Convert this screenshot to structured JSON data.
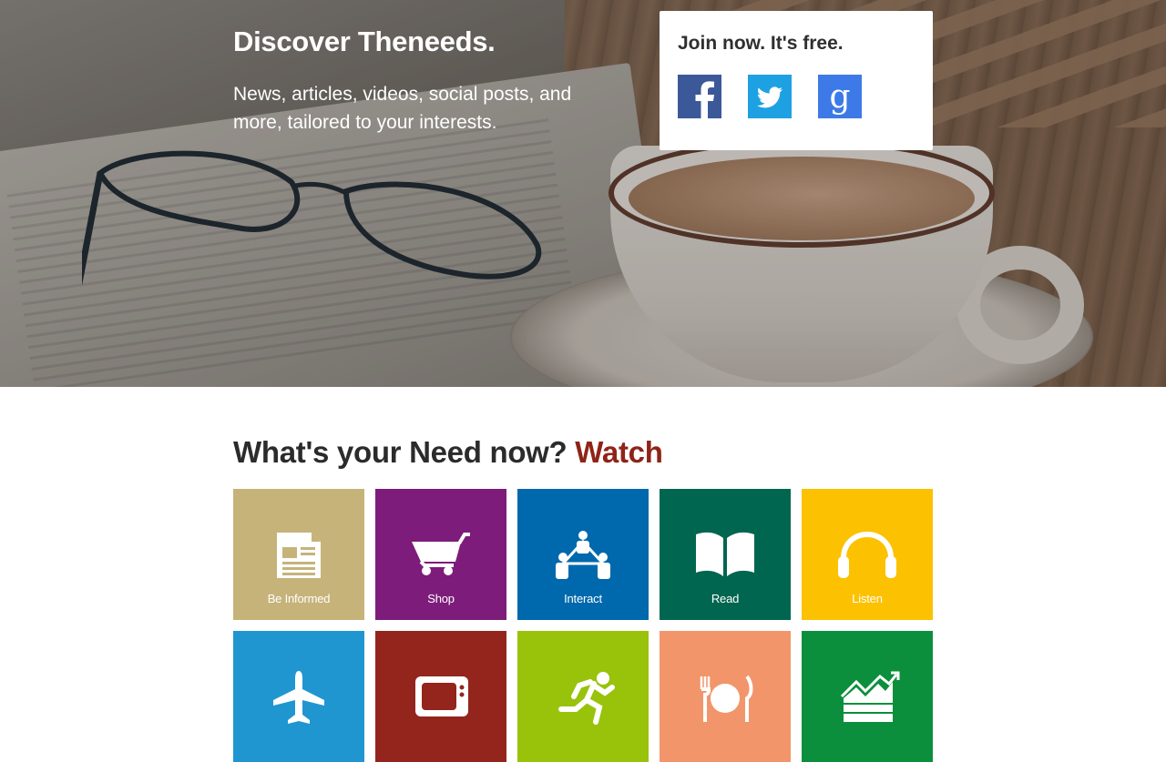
{
  "hero": {
    "title": "Discover Theneeds.",
    "subtitle": "News, articles, videos, social posts, and more, tailored to your interests."
  },
  "join": {
    "title": "Join now. It's free.",
    "social": [
      {
        "name": "facebook-icon",
        "color": "#3b5998"
      },
      {
        "name": "twitter-icon",
        "color": "#1da1e2"
      },
      {
        "name": "google-icon",
        "color": "#3d7ae8"
      }
    ]
  },
  "needs": {
    "title_prefix": "What's your Need now?",
    "title_accent": "Watch",
    "accent_color": "#8e2418",
    "tiles_row1": [
      {
        "label": "Be Informed",
        "icon": "newspaper-icon",
        "color": "#c6b37a"
      },
      {
        "label": "Shop",
        "icon": "cart-icon",
        "color": "#7d1c7b"
      },
      {
        "label": "Interact",
        "icon": "network-icon",
        "color": "#0068ac"
      },
      {
        "label": "Read",
        "icon": "book-icon",
        "color": "#006650"
      },
      {
        "label": "Listen",
        "icon": "headphones-icon",
        "color": "#fcc100"
      }
    ],
    "tiles_row2": [
      {
        "label": "",
        "icon": "airplane-icon",
        "color": "#2096d0"
      },
      {
        "label": "",
        "icon": "tv-icon",
        "color": "#93251d"
      },
      {
        "label": "",
        "icon": "runner-icon",
        "color": "#99c20b"
      },
      {
        "label": "",
        "icon": "dining-icon",
        "color": "#f2956b"
      },
      {
        "label": "",
        "icon": "stock-chart-icon",
        "color": "#0b8f3d"
      }
    ]
  }
}
